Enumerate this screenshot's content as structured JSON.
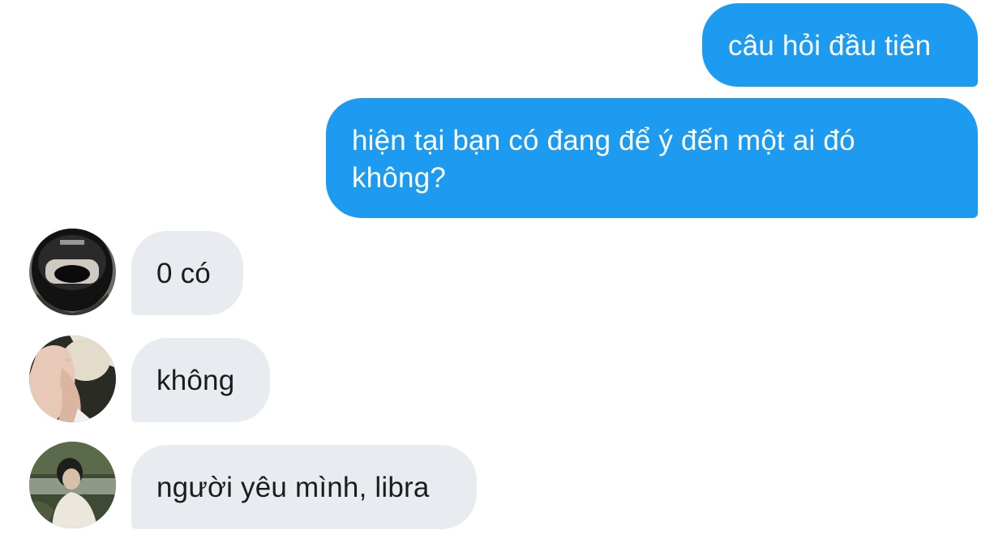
{
  "messages": {
    "sent": [
      {
        "text": "câu hỏi đầu tiên"
      },
      {
        "text": "hiện tại bạn có đang để ý đến một ai đó không?"
      }
    ],
    "received": [
      {
        "text": "0 có",
        "avatar": "avatar-helmet-photo"
      },
      {
        "text": "không",
        "avatar": "avatar-hands-photo"
      },
      {
        "text": "người yêu mình, libra",
        "avatar": "avatar-outdoor-photo"
      }
    ]
  },
  "colors": {
    "sent_bubble": "#1d9bf0",
    "sent_text": "#ffffff",
    "received_bubble": "#e8ecf0",
    "received_text": "#1c1c1e",
    "background": "#ffffff"
  }
}
